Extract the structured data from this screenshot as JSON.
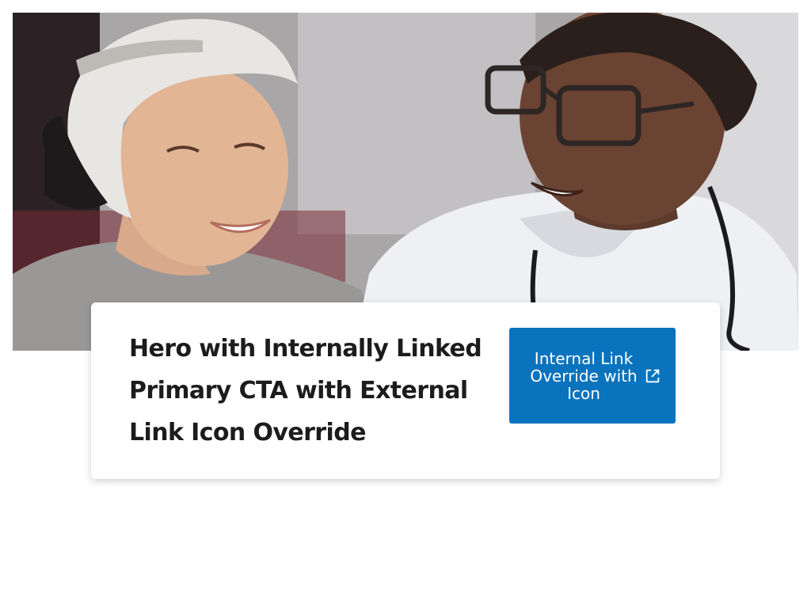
{
  "hero": {
    "title": "Hero with Internally Linked Primary CTA with External Link Icon Override",
    "cta": {
      "label": "Internal Link Override with Icon",
      "icon": "external-link-icon"
    }
  },
  "colors": {
    "cta_background": "#0a73bd",
    "cta_text": "#ffffff",
    "title_text": "#1c1c1c",
    "card_background": "#ffffff"
  }
}
